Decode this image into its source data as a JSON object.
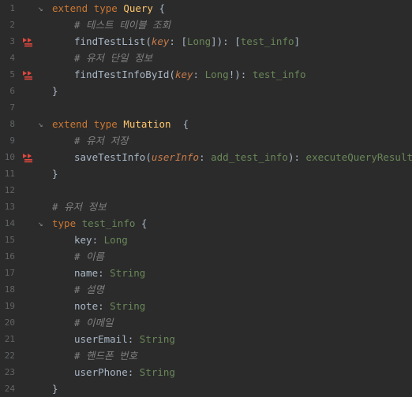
{
  "editor": {
    "lines": [
      {
        "num": "1",
        "fold": "↘",
        "indent": 0,
        "tokens": [
          {
            "t": "extend",
            "c": "kw"
          },
          {
            "t": " "
          },
          {
            "t": "type",
            "c": "kw"
          },
          {
            "t": " "
          },
          {
            "t": "Query",
            "c": "type"
          },
          {
            "t": " {",
            "c": "punct"
          }
        ]
      },
      {
        "num": "2",
        "indent": 1,
        "tokens": [
          {
            "t": "# 테스트 테이블 조회",
            "c": "comment"
          }
        ]
      },
      {
        "num": "3",
        "icon": "resolver",
        "indent": 1,
        "tokens": [
          {
            "t": "findTestList",
            "c": "fn"
          },
          {
            "t": "(",
            "c": "punct"
          },
          {
            "t": "key",
            "c": "param"
          },
          {
            "t": ": ",
            "c": "punct"
          },
          {
            "t": "[",
            "c": "punct"
          },
          {
            "t": "Long",
            "c": "scalar"
          },
          {
            "t": "]",
            "c": "punct"
          },
          {
            "t": "): ",
            "c": "punct"
          },
          {
            "t": "[",
            "c": "punct"
          },
          {
            "t": "test_info",
            "c": "scalar"
          },
          {
            "t": "]",
            "c": "punct"
          }
        ]
      },
      {
        "num": "4",
        "indent": 1,
        "tokens": [
          {
            "t": "# 유저 단일 정보",
            "c": "comment"
          }
        ]
      },
      {
        "num": "5",
        "icon": "resolver",
        "indent": 1,
        "tokens": [
          {
            "t": "findTestInfoById",
            "c": "fn"
          },
          {
            "t": "(",
            "c": "punct"
          },
          {
            "t": "key",
            "c": "param"
          },
          {
            "t": ": ",
            "c": "punct"
          },
          {
            "t": "Long",
            "c": "scalar"
          },
          {
            "t": "!",
            "c": "punct"
          },
          {
            "t": "): ",
            "c": "punct"
          },
          {
            "t": "test_info",
            "c": "scalar"
          }
        ]
      },
      {
        "num": "6",
        "indent": 0,
        "tokens": [
          {
            "t": "}",
            "c": "punct"
          }
        ]
      },
      {
        "num": "7",
        "indent": 0,
        "tokens": []
      },
      {
        "num": "8",
        "fold": "↘",
        "indent": 0,
        "tokens": [
          {
            "t": "extend",
            "c": "kw"
          },
          {
            "t": " "
          },
          {
            "t": "type",
            "c": "kw"
          },
          {
            "t": " "
          },
          {
            "t": "Mutation",
            "c": "type"
          },
          {
            "t": "  {",
            "c": "punct"
          }
        ]
      },
      {
        "num": "9",
        "indent": 1,
        "tokens": [
          {
            "t": "# 유저 저장",
            "c": "comment"
          }
        ]
      },
      {
        "num": "10",
        "icon": "resolver",
        "indent": 1,
        "tokens": [
          {
            "t": "saveTestInfo",
            "c": "fn"
          },
          {
            "t": "(",
            "c": "punct"
          },
          {
            "t": "userInfo",
            "c": "param"
          },
          {
            "t": ": ",
            "c": "punct"
          },
          {
            "t": "add_test_info",
            "c": "scalar"
          },
          {
            "t": "): ",
            "c": "punct"
          },
          {
            "t": "executeQueryResult",
            "c": "scalar"
          }
        ]
      },
      {
        "num": "11",
        "indent": 0,
        "tokens": [
          {
            "t": "}",
            "c": "punct"
          }
        ]
      },
      {
        "num": "12",
        "indent": 0,
        "tokens": []
      },
      {
        "num": "13",
        "indent": 0,
        "tokens": [
          {
            "t": "# 유저 정보",
            "c": "comment"
          }
        ]
      },
      {
        "num": "14",
        "fold": "↘",
        "indent": 0,
        "tokens": [
          {
            "t": "type",
            "c": "kw"
          },
          {
            "t": " "
          },
          {
            "t": "test_info",
            "c": "scalar"
          },
          {
            "t": " {",
            "c": "punct"
          }
        ]
      },
      {
        "num": "15",
        "indent": 1,
        "tokens": [
          {
            "t": "key",
            "c": "field"
          },
          {
            "t": ": ",
            "c": "punct"
          },
          {
            "t": "Long",
            "c": "scalar"
          }
        ]
      },
      {
        "num": "16",
        "indent": 1,
        "tokens": [
          {
            "t": "# 이름",
            "c": "comment"
          }
        ]
      },
      {
        "num": "17",
        "indent": 1,
        "tokens": [
          {
            "t": "name",
            "c": "field"
          },
          {
            "t": ": ",
            "c": "punct"
          },
          {
            "t": "String",
            "c": "scalar"
          }
        ]
      },
      {
        "num": "18",
        "indent": 1,
        "tokens": [
          {
            "t": "# 설명",
            "c": "comment"
          }
        ]
      },
      {
        "num": "19",
        "indent": 1,
        "tokens": [
          {
            "t": "note",
            "c": "field"
          },
          {
            "t": ": ",
            "c": "punct"
          },
          {
            "t": "String",
            "c": "scalar"
          }
        ]
      },
      {
        "num": "20",
        "indent": 1,
        "tokens": [
          {
            "t": "# 이메일",
            "c": "comment"
          }
        ]
      },
      {
        "num": "21",
        "indent": 1,
        "tokens": [
          {
            "t": "userEmail",
            "c": "field"
          },
          {
            "t": ": ",
            "c": "punct"
          },
          {
            "t": "String",
            "c": "scalar"
          }
        ]
      },
      {
        "num": "22",
        "indent": 1,
        "tokens": [
          {
            "t": "# 핸드폰 번호",
            "c": "comment"
          }
        ]
      },
      {
        "num": "23",
        "indent": 1,
        "tokens": [
          {
            "t": "userPhone",
            "c": "field"
          },
          {
            "t": ": ",
            "c": "punct"
          },
          {
            "t": "String",
            "c": "scalar"
          }
        ]
      },
      {
        "num": "24",
        "indent": 0,
        "tokens": [
          {
            "t": "}",
            "c": "punct"
          }
        ]
      }
    ]
  }
}
